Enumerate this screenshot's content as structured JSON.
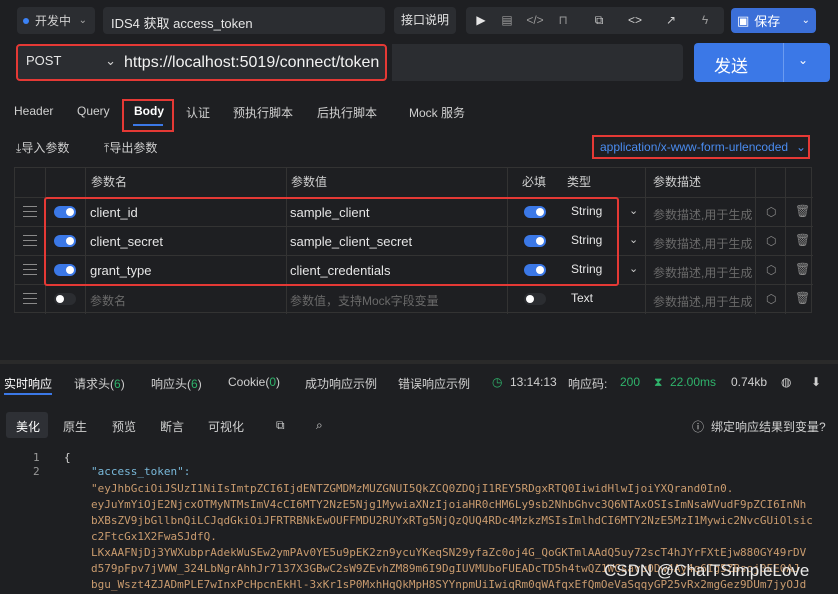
{
  "topbar": {
    "status": "开发中",
    "api_name": "IDS4 获取 access_token",
    "doc_label": "接口说明",
    "save_label": "保存"
  },
  "request": {
    "method": "POST",
    "url": "https://localhost:5019/connect/token",
    "send_label": "发送"
  },
  "tabs": [
    "Header",
    "Query",
    "Body",
    "认证",
    "预执行脚本",
    "后执行脚本",
    "Mock 服务"
  ],
  "body_actions": {
    "import_label": "导入参数",
    "export_label": "导出参数",
    "content_type": "application/x-www-form-urlencoded"
  },
  "table": {
    "headers": {
      "name": "参数名",
      "value": "参数值",
      "required": "必填",
      "type": "类型",
      "desc": "参数描述"
    },
    "rows": [
      {
        "name": "client_id",
        "value": "sample_client",
        "type": "String",
        "desc": "参数描述,用于生成"
      },
      {
        "name": "client_secret",
        "value": "sample_client_secret",
        "type": "String",
        "desc": "参数描述,用于生成"
      },
      {
        "name": "grant_type",
        "value": "client_credentials",
        "type": "String",
        "desc": "参数描述,用于生成"
      }
    ],
    "new_row": {
      "name_placeholder": "参数名",
      "value_placeholder": "参数值，支持Mock字段变量",
      "type": "Text",
      "desc_placeholder": "参数描述,用于生成"
    }
  },
  "response": {
    "tabs": {
      "realtime": "实时响应",
      "req_headers": "请求头",
      "req_headers_count": "6",
      "resp_headers": "响应头",
      "resp_headers_count": "6",
      "cookie": "Cookie",
      "cookie_count": "0",
      "success_example": "成功响应示例",
      "error_example": "错误响应示例"
    },
    "time": "13:14:13",
    "code_label": "响应码:",
    "code": "200",
    "duration": "22.00ms",
    "size": "0.74kb",
    "subtabs": [
      "美化",
      "原生",
      "预览",
      "断言",
      "可视化"
    ],
    "bind_label": "绑定响应结果到变量?",
    "code_lines": {
      "ln1": "1",
      "ln2": "2",
      "open_brace": "{",
      "key": "\"access_token\":",
      "val1": "\"eyJhbGciOiJSUzI1NiIsImtpZCI6IjdENTZGMDMzMUZGNUI5QkZCQ0ZDQjI1REY5RDgxRTQ0IiwidHlwIjoiYXQrand0In0.",
      "val2": "eyJuYmYiOjE2NjcxOTMyNTMsImV4cCI6MTY2NzE5Njg1MywiaXNzIjoiaHR0cHM6Ly9sb2NhbGhvc3Q6NTAxOSIsImNsaWVudF9pZCI6InNh",
      "val3": "bXBsZV9jbGllbnQiLCJqdGkiOiJFRTRBNkEwOUFFMDU2RUYxRTg5NjQzQUQ4RDc4MzkzMSIsImlhdCI6MTY2NzE5MzI1Mywic2NvcGUiOlsic",
      "val4": "c2FtcGx1X2FwaSJdfQ.",
      "val5": "LKxAAFNjDj3YWXubprAdekWuSEw2ymPAv0YE5u9pEK2zn9ycuYKeqSN29yfaZc0oj4G_QoGKTmlAAdQ5uy72scT4hJYrFXtEjw880GY49rDV",
      "val6": "d579pFpv7jVWW_324LbNgrAhhJr7137X3GBwC2sW9ZEvhZM89m6I9DgIUVMUboFUEADcTD5h4twQZ1WCsavu0Dw4Ay4q6Ig5ZBsoj0EE0AJ",
      "val7": "bgu_Wszt4ZJADmPLE7wInxPcHpcnEkHl-3xKr1sP0MxhHqQkMpH8SYYnpmUiIwiqRm0qWAfqxEfQmOeVaSqqyGP25vRx2mgGez9DUm7jyOJd"
    }
  },
  "watermark": "CSDN @ChaITSimpleLove"
}
